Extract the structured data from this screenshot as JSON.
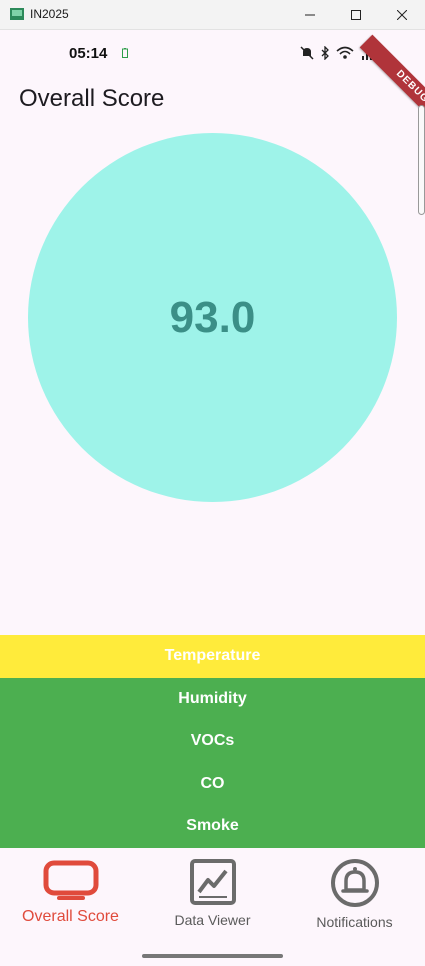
{
  "window": {
    "title": "IN2025"
  },
  "status_bar": {
    "time": "05:14"
  },
  "debug_banner": "DEBUG",
  "page": {
    "title": "Overall Score",
    "score": "93.0"
  },
  "metrics": [
    {
      "label": "Temperature",
      "color": "#ffeb3b"
    },
    {
      "label": "Humidity",
      "color": "#4caf50"
    },
    {
      "label": "VOCs",
      "color": "#4caf50"
    },
    {
      "label": "CO",
      "color": "#4caf50"
    },
    {
      "label": "Smoke",
      "color": "#4caf50"
    }
  ],
  "nav": [
    {
      "label": "Overall Score",
      "icon": "monitor-icon",
      "active": true
    },
    {
      "label": "Data Viewer",
      "icon": "chart-icon",
      "active": false
    },
    {
      "label": "Notifications",
      "icon": "bell-icon",
      "active": false
    }
  ],
  "colors": {
    "accent": "#e04b3c",
    "score_circle": "#9ef3e9",
    "score_text": "#3b8f87"
  }
}
